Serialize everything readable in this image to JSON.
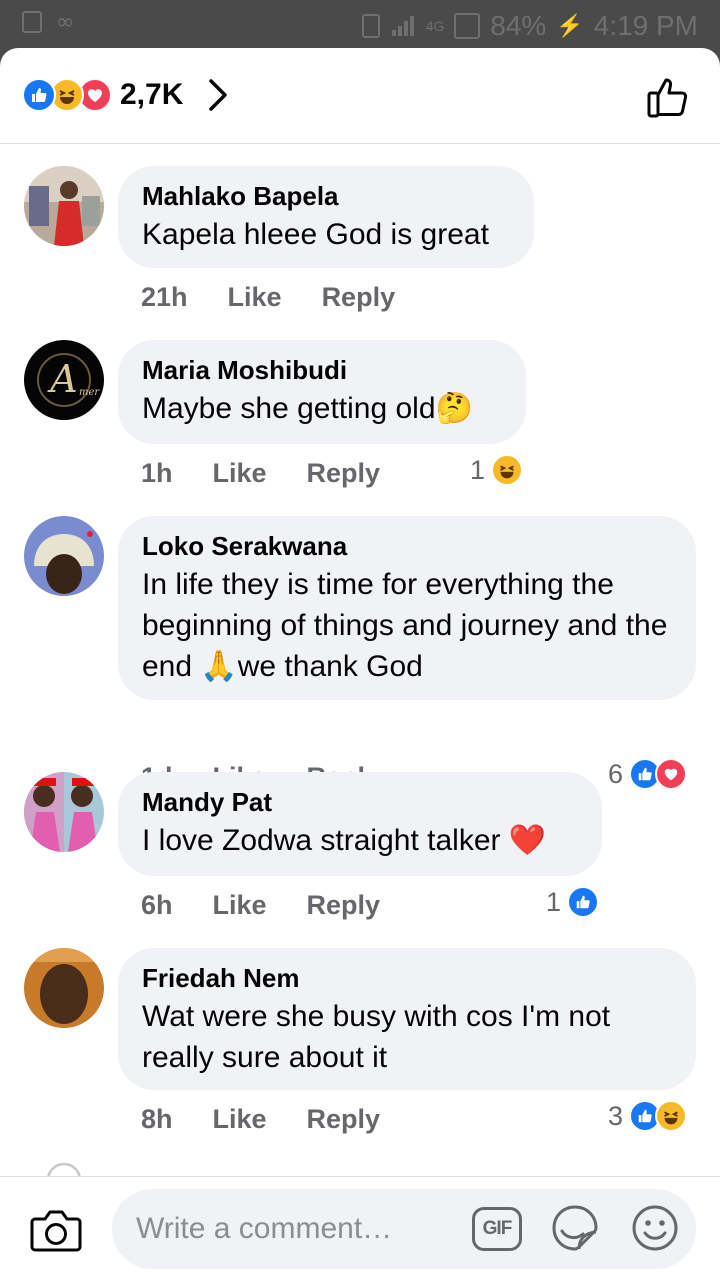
{
  "status_bar": {
    "battery": "84%",
    "time": "4:19 PM",
    "network": "4G"
  },
  "header": {
    "reaction_icons": [
      "like-icon",
      "haha-icon",
      "love-icon"
    ],
    "reaction_count": "2,7K",
    "chevron_icon": "chevron-right-icon",
    "like_button_icon": "thumbs-up-outline-icon"
  },
  "comments": [
    {
      "author": "Mahlako Bapela",
      "text": "Kapela hleee God is great",
      "time": "21h",
      "like_label": "Like",
      "reply_label": "Reply",
      "reaction_count": "",
      "reactions": []
    },
    {
      "author": "Maria Moshibudi",
      "text": "Maybe she getting old🤔",
      "time": "1h",
      "like_label": "Like",
      "reply_label": "Reply",
      "reaction_count": "1",
      "reactions": [
        "haha"
      ]
    },
    {
      "author": "Loko Serakwana",
      "text": "In life they is time for everything the beginning of things and journey and the end 🙏we thank God",
      "time": "1d",
      "like_label": "Like",
      "reply_label": "Reply",
      "reaction_count": "6",
      "reactions": [
        "like",
        "love"
      ]
    },
    {
      "author": "Mandy Pat",
      "text": "I love Zodwa straight talker ❤️",
      "time": "6h",
      "like_label": "Like",
      "reply_label": "Reply",
      "reaction_count": "1",
      "reactions": [
        "like"
      ]
    },
    {
      "author": "Friedah Nem",
      "text": "Wat were she busy with cos I'm not really sure about it",
      "time": "8h",
      "like_label": "Like",
      "reply_label": "Reply",
      "reaction_count": "3",
      "reactions": [
        "like",
        "haha"
      ]
    }
  ],
  "composer": {
    "placeholder": "Write a comment…",
    "gif_label": "GIF",
    "camera_icon": "camera-icon",
    "sticker_icon": "sticker-icon",
    "emoji_icon": "emoji-icon"
  },
  "colors": {
    "like_blue": "#1877f2",
    "love_red": "#f33e58",
    "haha_yellow": "#f7b928",
    "bubble_bg": "#f0f2f5",
    "meta_gray": "#65676b"
  }
}
